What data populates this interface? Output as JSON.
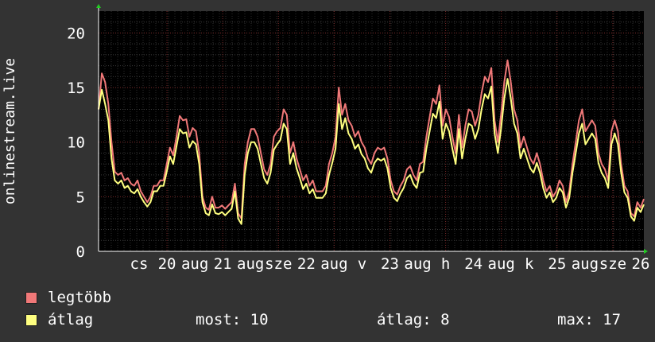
{
  "chart_data": {
    "type": "line",
    "ylabel": "onlinestream.live",
    "ylim": [
      0,
      22
    ],
    "y_ticks": [
      0,
      5,
      10,
      15,
      20
    ],
    "x_ticks": [
      "cs",
      "20",
      "aug",
      "21",
      "aug",
      "sze",
      "22",
      "aug",
      "v",
      "23",
      "aug",
      "h",
      "24",
      "aug",
      "k",
      "25",
      "aug",
      "sze",
      "26"
    ],
    "grid": true,
    "x": [
      0,
      1,
      2,
      3,
      4,
      5,
      6,
      7,
      8,
      9,
      10,
      11,
      12,
      13,
      14,
      15,
      16,
      17,
      18,
      19,
      20,
      21,
      22,
      23,
      24,
      25,
      26,
      27,
      28,
      29,
      30,
      31,
      32,
      33,
      34,
      35,
      36,
      37,
      38,
      39,
      40,
      41,
      42,
      43,
      44,
      45,
      46,
      47,
      48,
      49,
      50,
      51,
      52,
      53,
      54,
      55,
      56,
      57,
      58,
      59,
      60,
      61,
      62,
      63,
      64,
      65,
      66,
      67,
      68,
      69,
      70,
      71,
      72,
      73,
      74,
      75,
      76,
      77,
      78,
      79,
      80,
      81,
      82,
      83,
      84,
      85,
      86,
      87,
      88,
      89,
      90,
      91,
      92,
      93,
      94,
      95,
      96,
      97,
      98,
      99,
      100,
      101,
      102,
      103,
      104,
      105,
      106,
      107,
      108,
      109,
      110,
      111,
      112,
      113,
      114,
      115,
      116,
      117,
      118,
      119,
      120,
      121,
      122,
      123,
      124,
      125,
      126,
      127,
      128,
      129,
      130,
      131,
      132,
      133,
      134,
      135,
      136,
      137,
      138,
      139,
      140,
      141,
      142,
      143,
      144,
      145,
      146,
      147,
      148,
      149,
      150,
      151,
      152,
      153,
      154,
      155,
      156,
      157,
      158,
      159,
      160,
      161,
      162,
      163,
      164,
      165,
      166,
      167,
      168
    ],
    "series": [
      {
        "name": "legtöbb",
        "color": "#f07878",
        "values": [
          13,
          16.3,
          15.5,
          13.5,
          10,
          7.3,
          7,
          7.2,
          6.5,
          6.7,
          6.2,
          6,
          6.5,
          5.5,
          5,
          4.5,
          5,
          6,
          6,
          6.5,
          6.5,
          8,
          9.5,
          8.8,
          10.5,
          12.4,
          12,
          12.1,
          10.5,
          11.3,
          11,
          9,
          5,
          4,
          3.8,
          5,
          4,
          4,
          4.2,
          3.9,
          4.2,
          4.5,
          6.2,
          3.5,
          3,
          8,
          10,
          11.2,
          11.2,
          10.5,
          9,
          7.5,
          7,
          8,
          10.5,
          11,
          11.3,
          13,
          12.5,
          9,
          10,
          8.5,
          7.5,
          6.5,
          7,
          6,
          6.5,
          5.5,
          5.5,
          5.5,
          6,
          8,
          9,
          10.5,
          15,
          12.5,
          13.5,
          12,
          11.5,
          10.5,
          11,
          10,
          9.5,
          8.5,
          8,
          9,
          9.5,
          9.3,
          9.5,
          8.5,
          6.5,
          5.5,
          5.2,
          6,
          6.5,
          7.5,
          7.8,
          7,
          6.5,
          8,
          8.2,
          10.5,
          12.3,
          14,
          13.5,
          15.2,
          11.5,
          13,
          12.3,
          10.5,
          9,
          12.5,
          9.5,
          11.5,
          13,
          12.8,
          11.5,
          12.5,
          14.5,
          16,
          15.5,
          16.8,
          12,
          10,
          12.5,
          15.5,
          17.5,
          15.5,
          13,
          12,
          9.5,
          10.5,
          9.5,
          8.5,
          8,
          9,
          8,
          6.5,
          5.5,
          6,
          5,
          5.5,
          6.5,
          6,
          4.5,
          5.5,
          8,
          10,
          12,
          13,
          11,
          11.5,
          12,
          11.5,
          9,
          8,
          7.5,
          6.5,
          11,
          12,
          11,
          8,
          6,
          5.5,
          3.5,
          3.2,
          4.5,
          4,
          4.8,
          6,
          9,
          12,
          14,
          15,
          14
        ]
      },
      {
        "name": "átlag",
        "color": "#ffff80",
        "values": [
          13,
          14.8,
          13.5,
          12,
          8.5,
          6.5,
          6.2,
          6.5,
          5.8,
          6,
          5.5,
          5.3,
          5.7,
          5,
          4.5,
          4.1,
          4.5,
          5.5,
          5.5,
          6,
          6,
          7.3,
          8.7,
          8,
          9.6,
          11.2,
          10.8,
          10.9,
          9.5,
          10.1,
          9.8,
          8,
          4.5,
          3.5,
          3.3,
          4.3,
          3.5,
          3.4,
          3.6,
          3.3,
          3.6,
          3.9,
          5.5,
          3,
          2.5,
          7,
          9,
          10,
          10,
          9.4,
          8,
          6.7,
          6.2,
          7.2,
          9.3,
          9.8,
          10.2,
          11.7,
          11.2,
          8,
          9,
          7.6,
          6.7,
          5.7,
          6.2,
          5.3,
          5.7,
          4.9,
          4.9,
          4.9,
          5.3,
          7,
          8.1,
          9.4,
          13.5,
          11.2,
          12.2,
          10.8,
          10.3,
          9.4,
          9.8,
          8.9,
          8.5,
          7.6,
          7.2,
          8.1,
          8.5,
          8.3,
          8.5,
          7.6,
          5.8,
          4.9,
          4.6,
          5.3,
          5.8,
          6.7,
          7,
          6.2,
          5.8,
          7.2,
          7.3,
          9.4,
          11,
          12.6,
          12.2,
          13.7,
          10.3,
          11.7,
          11,
          9.4,
          8,
          11.2,
          8.5,
          10.3,
          11.7,
          11.5,
          10.3,
          11.2,
          13,
          14.4,
          14,
          15.1,
          10.8,
          9,
          11.2,
          14,
          15.8,
          14,
          11.7,
          10.8,
          8.5,
          9.4,
          8.5,
          7.6,
          7.2,
          8.1,
          7.2,
          5.8,
          4.9,
          5.4,
          4.5,
          4.9,
          5.8,
          5.4,
          4,
          4.9,
          7.2,
          9,
          10.8,
          11.7,
          9.8,
          10.3,
          10.8,
          10.3,
          8.1,
          7.2,
          6.7,
          5.8,
          9.8,
          10.8,
          9.8,
          7.2,
          5.4,
          4.9,
          3.2,
          2.8,
          4,
          3.6,
          4.3,
          5.4,
          8.1,
          10.8,
          12.6,
          13.5,
          12.6
        ]
      }
    ]
  },
  "legend": {
    "max_label": "legtöbb",
    "avg_label": "átlag",
    "max_color": "#f07878",
    "avg_color": "#ffff80"
  },
  "stats": {
    "now": "most: 10",
    "avg": "átlag: 8",
    "max": "max: 17"
  }
}
